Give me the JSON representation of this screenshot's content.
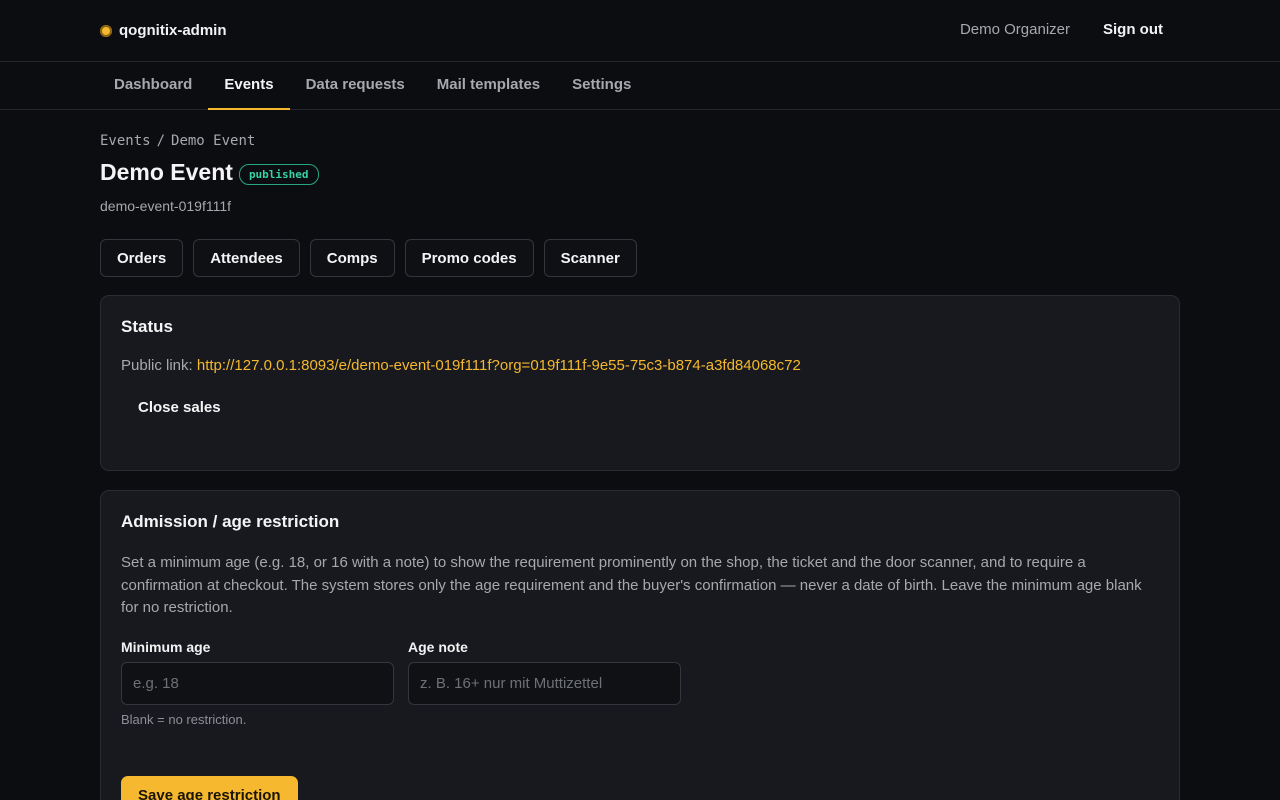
{
  "header": {
    "brand": "qognitix-admin",
    "brand_icon": "circle-dot-icon",
    "user_name": "Demo Organizer",
    "sign_out": "Sign out",
    "accent": "#f5b82e"
  },
  "nav": {
    "tabs": [
      {
        "label": "Dashboard",
        "active": false
      },
      {
        "label": "Events",
        "active": true
      },
      {
        "label": "Data requests",
        "active": false
      },
      {
        "label": "Mail templates",
        "active": false
      },
      {
        "label": "Settings",
        "active": false
      }
    ]
  },
  "breadcrumb": {
    "parent": "Events",
    "separator": "/",
    "current": "Demo Event"
  },
  "event": {
    "title": "Demo Event",
    "status_badge": "published",
    "slug": "demo-event-019f111f"
  },
  "actions": [
    "Orders",
    "Attendees",
    "Comps",
    "Promo codes",
    "Scanner"
  ],
  "status_card": {
    "title": "Status",
    "public_link_label": "Public link:",
    "public_link": "http://127.0.0.1:8093/e/demo-event-019f111f?org=019f111f-9e55-75c3-b874-a3fd84068c72",
    "close_sales": "Close sales"
  },
  "age_card": {
    "title": "Admission / age restriction",
    "description": "Set a minimum age (e.g. 18, or 16 with a note) to show the requirement prominently on the shop, the ticket and the door scanner, and to require a confirmation at checkout. The system stores only the age requirement and the buyer's confirmation — never a date of birth. Leave the minimum age blank for no restriction.",
    "min_age_label": "Minimum age",
    "min_age_value": "",
    "min_age_placeholder": "e.g. 18",
    "min_age_hint": "Blank = no restriction.",
    "note_label": "Age note",
    "note_value": "",
    "note_placeholder": "z. B. 16+ nur mit Muttizettel",
    "save_label": "Save age restriction"
  }
}
